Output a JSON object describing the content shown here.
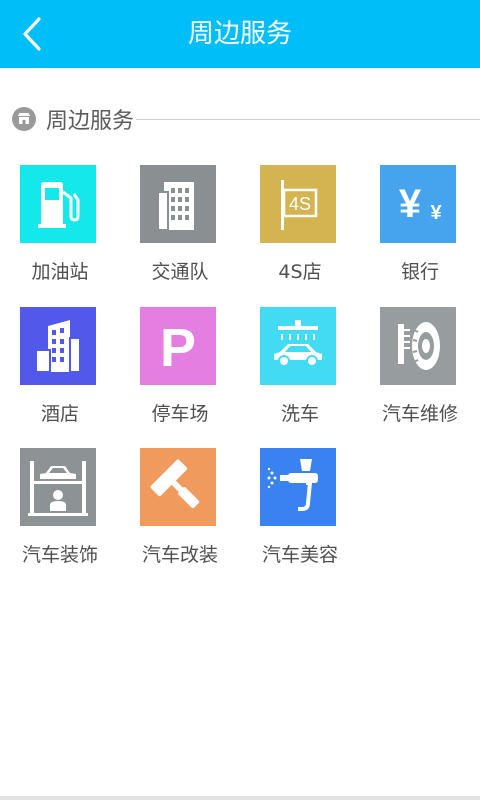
{
  "header": {
    "title": "周边服务",
    "back_icon": "chevron-left-icon"
  },
  "section": {
    "title": "周边服务",
    "icon": "store-icon"
  },
  "colors": {
    "app_bar": "#00bff8",
    "gas_station": "#14e8ea",
    "traffic_police": "#8a8f91",
    "4s_store": "#d3b450",
    "bank": "#46a4ef",
    "hotel": "#5158ea",
    "parking": "#e47ee0",
    "car_wash": "#43dbf4",
    "repair": "#979d9f",
    "decoration": "#8d9394",
    "modification": "#f09a5e",
    "beauty": "#3a82ef"
  },
  "services": [
    {
      "label": "加油站",
      "icon": "gas-pump-icon"
    },
    {
      "label": "交通队",
      "icon": "building-icon"
    },
    {
      "label": "4S店",
      "icon": "4s-sign-icon",
      "badge": "4S"
    },
    {
      "label": "银行",
      "icon": "yen-icon",
      "symbol_large": "¥",
      "symbol_small": "¥"
    },
    {
      "label": "酒店",
      "icon": "hotel-icon"
    },
    {
      "label": "停车场",
      "icon": "parking-icon",
      "letter": "P"
    },
    {
      "label": "洗车",
      "icon": "car-wash-icon"
    },
    {
      "label": "汽车维修",
      "icon": "tire-icon"
    },
    {
      "label": "汽车装饰",
      "icon": "car-lift-icon"
    },
    {
      "label": "汽车改装",
      "icon": "paint-roller-icon"
    },
    {
      "label": "汽车美容",
      "icon": "spray-gun-icon"
    }
  ]
}
